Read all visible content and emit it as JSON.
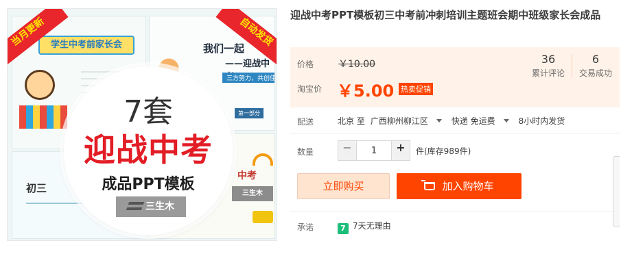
{
  "product_image": {
    "ribbon_left": "当月更新",
    "ribbon_right": "自动发货",
    "slide1_banner": "学生中考前家长会",
    "slide2_title": "我们一起",
    "slide2_subtitle": "——迎战中考",
    "slide2_tagline": "三方努力，共创佳绩",
    "slide2_badge": "第一部分",
    "slide3_title": "初三",
    "slide4_title": "中考",
    "slide4_brand": "三生木",
    "circle_count": "7套",
    "circle_headline": "迎战中考",
    "circle_sub": "成品PPT模板",
    "circle_brand": "三生木"
  },
  "product": {
    "title": "迎战中考PPT模板初三中考前冲刺培训主题班会期中班级家长会成品"
  },
  "price": {
    "original_label": "价格",
    "original_value": "￥10.00",
    "sale_label": "淘宝价",
    "sale_value": "￥5.00",
    "promo_badge": "热卖促销"
  },
  "stats": {
    "reviews_count": "36",
    "reviews_label": "累计评论",
    "deals_count": "6",
    "deals_label": "交易成功"
  },
  "shipping": {
    "label": "配送",
    "from": "北京 至",
    "to": "广西柳州柳江区",
    "method": "快递 免运费",
    "time": "8小时内发货"
  },
  "quantity": {
    "label": "数量",
    "value": "1",
    "minus": "−",
    "plus": "+",
    "stock": "件(库存989件)"
  },
  "actions": {
    "buy_now": "立即购买",
    "add_to_cart": "加入购物车"
  },
  "promise": {
    "label": "承诺",
    "badge": "7",
    "text": "7天无理由"
  },
  "colors": {
    "accent": "#ff4400",
    "price_panel_bg": "#fff2e8",
    "promise_badge": "#1cbf7a",
    "headline_red": "#e21d25"
  }
}
